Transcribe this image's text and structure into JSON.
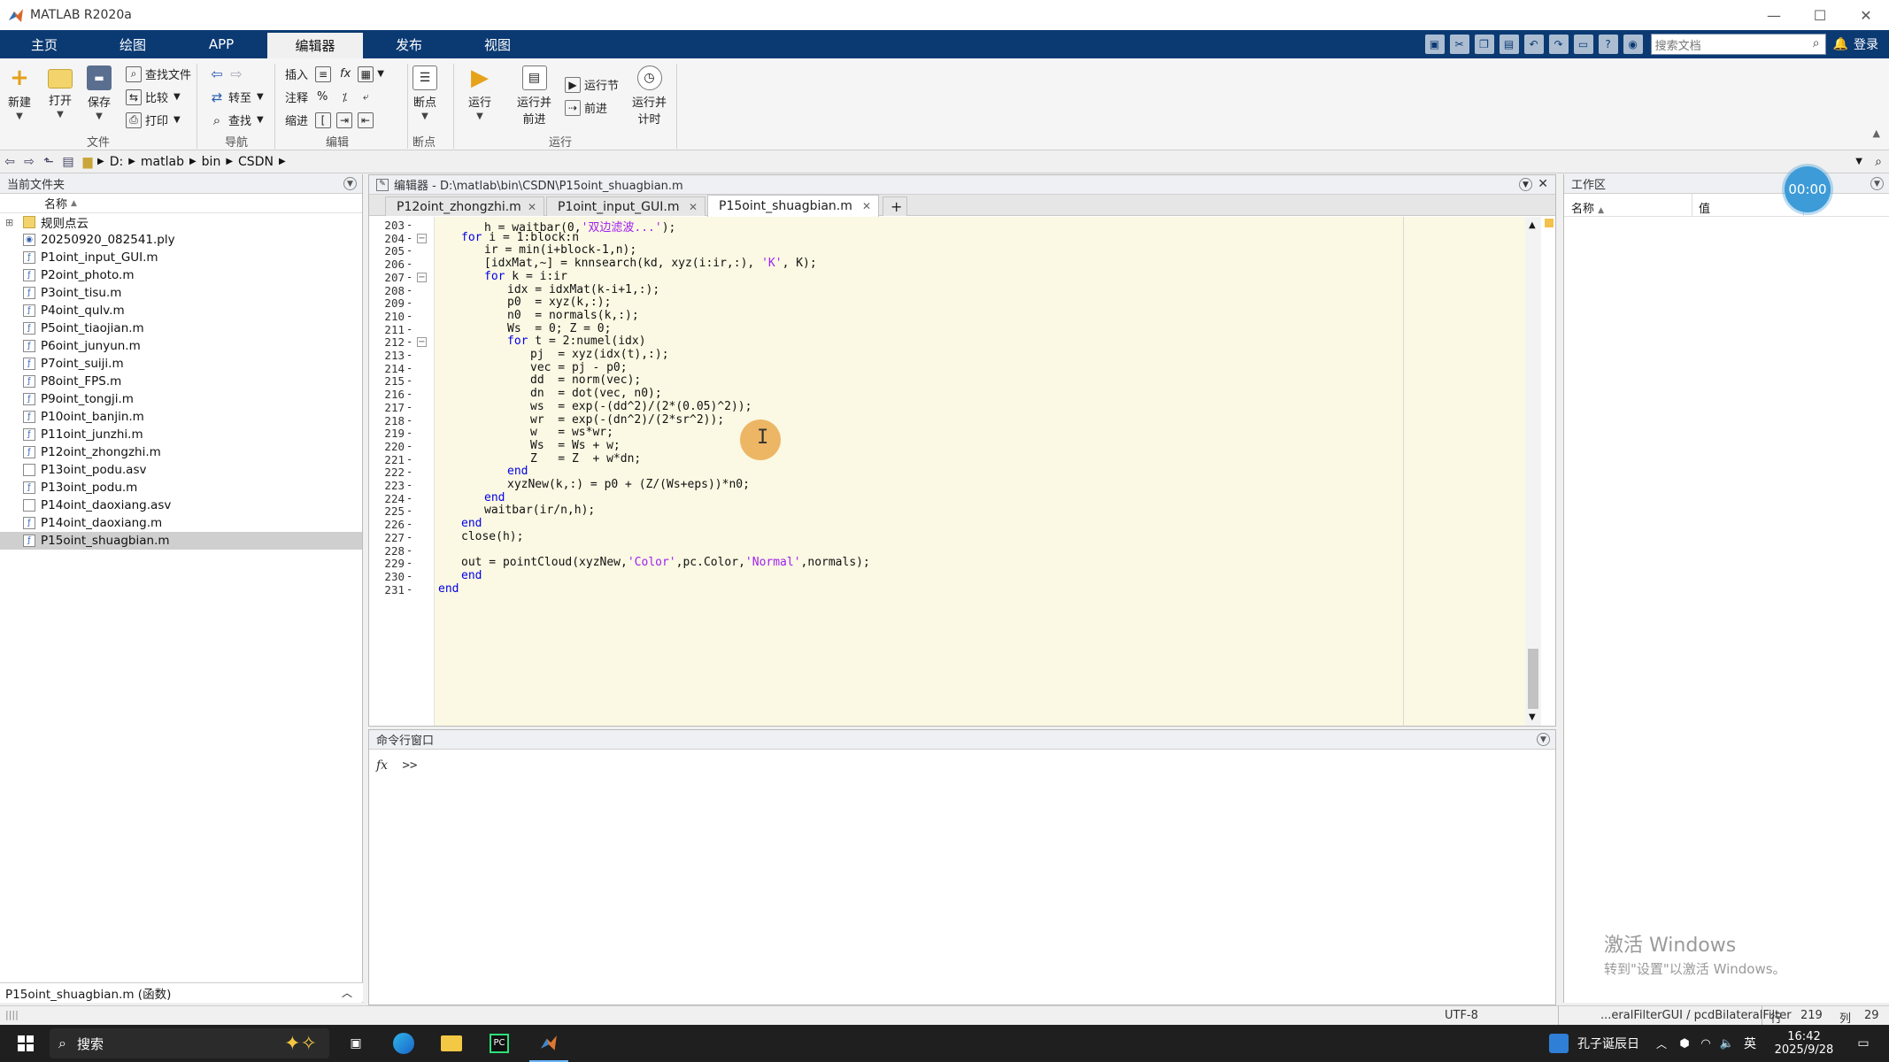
{
  "window": {
    "title": "MATLAB R2020a"
  },
  "ribbon": {
    "tabs": [
      "主页",
      "绘图",
      "APP",
      "编辑器",
      "发布",
      "视图"
    ],
    "active_tab": "编辑器",
    "search_placeholder": "搜索文档",
    "login": "登录",
    "file_group": {
      "label": "文件",
      "new": "新建",
      "open": "打开",
      "save": "保存",
      "find_files": "查找文件",
      "compare": "比较",
      "print": "打印"
    },
    "nav_group": {
      "label": "导航",
      "goto": "转至",
      "find": "查找"
    },
    "edit_group": {
      "label": "编辑",
      "insert": "插入",
      "comment": "注释",
      "indent": "缩进",
      "fx": "fx",
      "pct": "%"
    },
    "breakpoint_group": {
      "label": "断点",
      "breakpoints": "断点"
    },
    "run_group": {
      "label": "运行",
      "run": "运行",
      "run_advance": "运行并\n前进",
      "run_section": "运行节",
      "advance": "前进",
      "run_time": "运行并\n计时"
    }
  },
  "address": {
    "crumbs": [
      "D:",
      "matlab",
      "bin",
      "CSDN"
    ]
  },
  "current_folder": {
    "title": "当前文件夹",
    "column_name": "名称",
    "sort_indicator": "▲",
    "items": [
      {
        "name": "规则点云",
        "type": "folder"
      },
      {
        "name": "20250920_082541.ply",
        "type": "ply"
      },
      {
        "name": "P1oint_input_GUI.m",
        "type": "m"
      },
      {
        "name": "P2oint_photo.m",
        "type": "m"
      },
      {
        "name": "P3oint_tisu.m",
        "type": "m"
      },
      {
        "name": "P4oint_qulv.m",
        "type": "m"
      },
      {
        "name": "P5oint_tiaojian.m",
        "type": "m"
      },
      {
        "name": "P6oint_junyun.m",
        "type": "m"
      },
      {
        "name": "P7oint_suiji.m",
        "type": "m"
      },
      {
        "name": "P8oint_FPS.m",
        "type": "m"
      },
      {
        "name": "P9oint_tongji.m",
        "type": "m"
      },
      {
        "name": "P10oint_banjin.m",
        "type": "m"
      },
      {
        "name": "P11oint_junzhi.m",
        "type": "m"
      },
      {
        "name": "P12oint_zhongzhi.m",
        "type": "m"
      },
      {
        "name": "P13oint_podu.asv",
        "type": "asv"
      },
      {
        "name": "P13oint_podu.m",
        "type": "m"
      },
      {
        "name": "P14oint_daoxiang.asv",
        "type": "asv"
      },
      {
        "name": "P14oint_daoxiang.m",
        "type": "m"
      },
      {
        "name": "P15oint_shuagbian.m",
        "type": "m",
        "selected": true
      }
    ],
    "status": "P15oint_shuagbian.m  (函数)"
  },
  "editor": {
    "title": "编辑器 - D:\\matlab\\bin\\CSDN\\P15oint_shuagbian.m",
    "tabs": [
      "P12oint_zhongzhi.m",
      "P1oint_input_GUI.m",
      "P15oint_shuagbian.m"
    ],
    "active_tab": "P15oint_shuagbian.m",
    "add_tab": "+",
    "lines": [
      {
        "n": "203",
        "indent": 2,
        "parts": [
          [
            "h = waitbar(0,",
            ""
          ],
          [
            "'双边滤波...'",
            "str"
          ],
          [
            ");",
            ""
          ]
        ]
      },
      {
        "n": "204",
        "indent": 1,
        "fold": true,
        "parts": [
          [
            "for",
            "kw"
          ],
          [
            " i = 1:block:n",
            ""
          ]
        ]
      },
      {
        "n": "205",
        "indent": 2,
        "parts": [
          [
            "ir = min(i+block-1,n);",
            ""
          ]
        ]
      },
      {
        "n": "206",
        "indent": 2,
        "parts": [
          [
            "[idxMat,~] = knnsearch(kd, xyz(i:ir,:), ",
            ""
          ],
          [
            "'K'",
            "str"
          ],
          [
            ", K);",
            ""
          ]
        ]
      },
      {
        "n": "207",
        "indent": 2,
        "fold": true,
        "parts": [
          [
            "for",
            "kw"
          ],
          [
            " k = i:ir",
            ""
          ]
        ]
      },
      {
        "n": "208",
        "indent": 3,
        "parts": [
          [
            "idx = idxMat(k-i+1,:);",
            ""
          ]
        ]
      },
      {
        "n": "209",
        "indent": 3,
        "parts": [
          [
            "p0  = xyz(k,:);",
            ""
          ]
        ]
      },
      {
        "n": "210",
        "indent": 3,
        "parts": [
          [
            "n0  = normals(k,:);",
            ""
          ]
        ]
      },
      {
        "n": "211",
        "indent": 3,
        "parts": [
          [
            "Ws  = 0; Z = 0;",
            ""
          ]
        ]
      },
      {
        "n": "212",
        "indent": 3,
        "fold": true,
        "parts": [
          [
            "for",
            "kw"
          ],
          [
            " t = 2:numel(idx)",
            ""
          ]
        ]
      },
      {
        "n": "213",
        "indent": 4,
        "parts": [
          [
            "pj  = xyz(idx(t),:);",
            ""
          ]
        ]
      },
      {
        "n": "214",
        "indent": 4,
        "parts": [
          [
            "vec = pj - p0;",
            ""
          ]
        ]
      },
      {
        "n": "215",
        "indent": 4,
        "parts": [
          [
            "dd  = norm(vec);",
            ""
          ]
        ]
      },
      {
        "n": "216",
        "indent": 4,
        "parts": [
          [
            "dn  = dot(vec, n0);",
            ""
          ]
        ]
      },
      {
        "n": "217",
        "indent": 4,
        "parts": [
          [
            "ws  = exp(-(dd^2)/(2*(0.05)^2));",
            ""
          ]
        ]
      },
      {
        "n": "218",
        "indent": 4,
        "parts": [
          [
            "wr  = exp(-(dn^2)/(2*sr^2));",
            ""
          ]
        ]
      },
      {
        "n": "219",
        "indent": 4,
        "parts": [
          [
            "w   = ws*wr;",
            ""
          ]
        ]
      },
      {
        "n": "220",
        "indent": 4,
        "parts": [
          [
            "Ws  = Ws + w;",
            ""
          ]
        ]
      },
      {
        "n": "221",
        "indent": 4,
        "parts": [
          [
            "Z   = Z  + w*dn;",
            ""
          ]
        ]
      },
      {
        "n": "222",
        "indent": 3,
        "parts": [
          [
            "end",
            "kw"
          ]
        ]
      },
      {
        "n": "223",
        "indent": 3,
        "parts": [
          [
            "xyzNew(k,:) = p0 + (Z/(Ws+eps))*n0;",
            ""
          ]
        ]
      },
      {
        "n": "224",
        "indent": 2,
        "parts": [
          [
            "end",
            "kw"
          ]
        ]
      },
      {
        "n": "225",
        "indent": 2,
        "parts": [
          [
            "waitbar(ir/n,h);",
            ""
          ]
        ]
      },
      {
        "n": "226",
        "indent": 1,
        "parts": [
          [
            "end",
            "kw"
          ]
        ]
      },
      {
        "n": "227",
        "indent": 1,
        "parts": [
          [
            "close(h);",
            ""
          ]
        ]
      },
      {
        "n": "228",
        "indent": 1,
        "parts": []
      },
      {
        "n": "229",
        "indent": 1,
        "parts": [
          [
            "out = pointCloud(xyzNew,",
            ""
          ],
          [
            "'Color'",
            "str"
          ],
          [
            ",pc.Color,",
            ""
          ],
          [
            "'Normal'",
            "str"
          ],
          [
            ",normals);",
            ""
          ]
        ]
      },
      {
        "n": "230",
        "indent": 1,
        "parts": [
          [
            "end",
            "kw"
          ]
        ]
      },
      {
        "n": "231",
        "indent": 0,
        "parts": [
          [
            "end",
            "kw"
          ]
        ]
      }
    ]
  },
  "command_window": {
    "title": "命令行窗口",
    "fx": "fx",
    "prompt": ">>"
  },
  "workspace": {
    "title": "工作区",
    "col_name": "名称",
    "col_value": "值",
    "sort_indicator": "▲"
  },
  "timer": "00:00",
  "watermark": {
    "line1": "激活 Windows",
    "line2": "转到\"设置\"以激活 Windows。"
  },
  "statusbar": {
    "encoding": "UTF-8",
    "function": "...eralFilterGUI / pcdBilateralFilter",
    "row_label": "行",
    "row": "219",
    "col_label": "列",
    "col": "29"
  },
  "taskbar": {
    "search": "搜索",
    "widget": "孔子诞辰日",
    "lang": "英",
    "time": "16:42",
    "date": "2025/9/28"
  },
  "colors": {
    "ribbon_blue": "#0b3a73",
    "code_bg": "#fbf8e3",
    "keyword": "#0000e6",
    "string": "#a020f0"
  }
}
